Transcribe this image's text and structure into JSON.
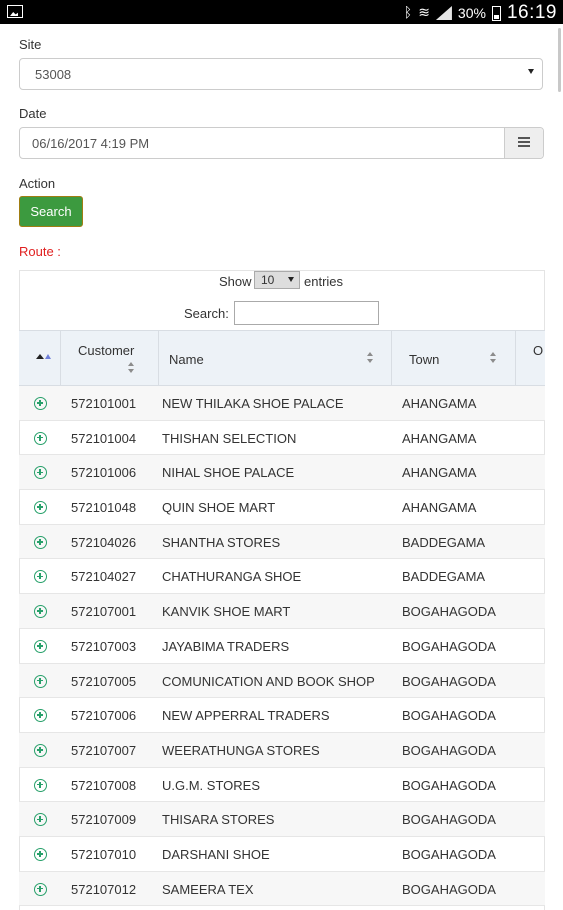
{
  "status_bar": {
    "battery_pct": "30%",
    "time": "16:19",
    "icons": [
      "gallery-icon",
      "bluetooth-icon",
      "wifi-icon",
      "signal-icon",
      "battery-icon"
    ]
  },
  "form": {
    "site_label": "Site",
    "site_value": "53008",
    "date_label": "Date",
    "date_value": "06/16/2017 4:19 PM",
    "action_label": "Action",
    "search_button": "Search",
    "route_label": "Route :"
  },
  "table_controls": {
    "show_label": "Show",
    "entries_value": "10",
    "entries_label": "entries",
    "search_label": "Search:",
    "search_value": ""
  },
  "columns": [
    "Customer",
    "Name",
    "Town",
    "O"
  ],
  "rows": [
    {
      "customer": "572101001",
      "name": "NEW THILAKA SHOE PALACE",
      "town": "AHANGAMA"
    },
    {
      "customer": "572101004",
      "name": "THISHAN SELECTION",
      "town": "AHANGAMA"
    },
    {
      "customer": "572101006",
      "name": "NIHAL SHOE PALACE",
      "town": "AHANGAMA"
    },
    {
      "customer": "572101048",
      "name": "QUIN SHOE MART",
      "town": "AHANGAMA"
    },
    {
      "customer": "572104026",
      "name": "SHANTHA STORES",
      "town": "BADDEGAMA"
    },
    {
      "customer": "572104027",
      "name": "CHATHURANGA SHOE",
      "town": "BADDEGAMA"
    },
    {
      "customer": "572107001",
      "name": "KANVIK SHOE MART",
      "town": "BOGAHAGODA"
    },
    {
      "customer": "572107003",
      "name": "JAYABIMA TRADERS",
      "town": "BOGAHAGODA"
    },
    {
      "customer": "572107005",
      "name": "COMUNICATION AND BOOK SHOP",
      "town": "BOGAHAGODA"
    },
    {
      "customer": "572107006",
      "name": "NEW APPERRAL TRADERS",
      "town": "BOGAHAGODA"
    },
    {
      "customer": "572107007",
      "name": "WEERATHUNGA STORES",
      "town": "BOGAHAGODA"
    },
    {
      "customer": "572107008",
      "name": "U.G.M. STORES",
      "town": "BOGAHAGODA"
    },
    {
      "customer": "572107009",
      "name": "THISARA STORES",
      "town": "BOGAHAGODA"
    },
    {
      "customer": "572107010",
      "name": "DARSHANI SHOE",
      "town": "BOGAHAGODA"
    },
    {
      "customer": "572107012",
      "name": "SAMEERA TEX",
      "town": "BOGAHAGODA"
    }
  ],
  "colors": {
    "primary_button": "#3c9a3f",
    "route_label": "#e02020",
    "expand_icon": "#27a06a"
  }
}
